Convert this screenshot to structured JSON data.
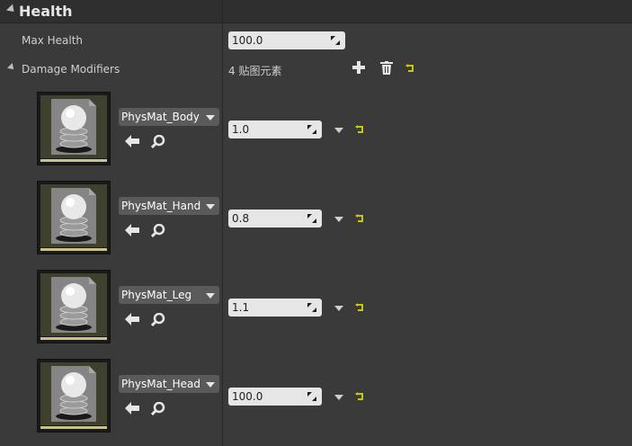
{
  "header": {
    "title": "Health"
  },
  "max_health": {
    "label": "Max Health",
    "value": "100.0"
  },
  "damage_modifiers": {
    "label": "Damage Modifiers",
    "element_count": "4 贴图元素",
    "items": [
      {
        "material": "PhysMat_Body",
        "value": "1.0"
      },
      {
        "material": "PhysMat_Hand",
        "value": "0.8"
      },
      {
        "material": "PhysMat_Leg",
        "value": "1.1"
      },
      {
        "material": "PhysMat_Head",
        "value": "100.0"
      }
    ]
  },
  "colors": {
    "panel_bg": "#3a3a3a",
    "header_bg": "#2f2f2f",
    "field_bg": "#e6e6e6",
    "reset_arrow": "#c8c800",
    "tile_bar": "#c9c28a"
  },
  "icons": {
    "add": "plus-icon",
    "delete": "trash-icon",
    "reset": "reset-to-default-icon",
    "use": "arrow-left-icon",
    "browse": "magnifier-icon"
  }
}
